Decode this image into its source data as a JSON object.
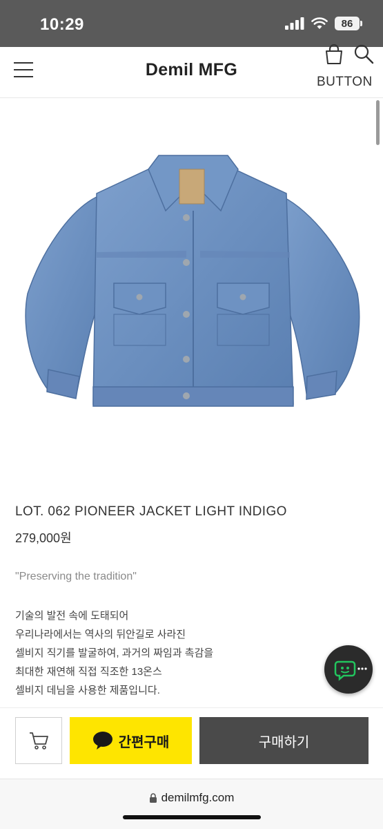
{
  "status_bar": {
    "time": "10:29",
    "battery": "86"
  },
  "header": {
    "brand": "Demil MFG",
    "button_label": "BUTTON"
  },
  "product": {
    "name": "LOT. 062 PIONEER JACKET LIGHT INDIGO",
    "price": "279,000원",
    "tagline": "\"Preserving the tradition\"",
    "description": [
      "기술의 발전 속에 도태되어",
      "우리나라에서는 역사의 뒤안길로 사라진",
      "셀비지 직기를 발굴하여, 과거의 짜임과 촉감을",
      "최대한 재연해 직접 직조한 13온스",
      "셀비지 데님을 사용한 제품입니다."
    ]
  },
  "buy_bar": {
    "kakao_label": "간편구매",
    "buy_label": "구매하기"
  },
  "browser": {
    "url": "demilmfg.com"
  },
  "colors": {
    "kakao": "#fee500",
    "buy_button": "#4a4a4a",
    "chat_fab": "#2b2b2b",
    "chat_icon": "#22c55e",
    "denim": "#6b8fbf"
  }
}
